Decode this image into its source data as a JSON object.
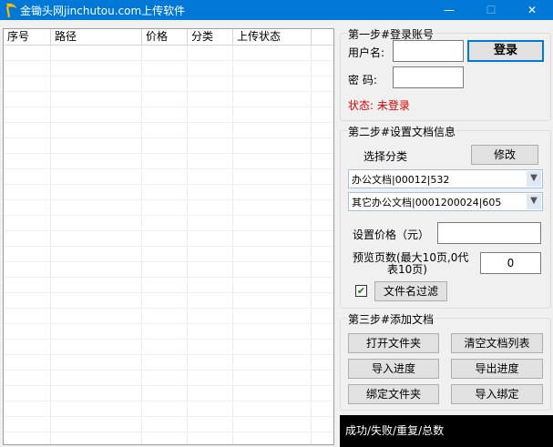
{
  "window": {
    "title": "金锄头网jinchutou.com上传软件",
    "minimize_glyph": "—",
    "maximize_glyph": "☐",
    "close_glyph": "✕",
    "app_icon": "golden-hoe-logo-icon"
  },
  "file_list": {
    "columns": [
      "序号",
      "路径",
      "价格",
      "分类",
      "上传状态"
    ],
    "rows": []
  },
  "step1": {
    "legend": "第一步#登录账号",
    "username_label": "用户名:",
    "username_value": "",
    "password_label": "密   码:",
    "password_value": "",
    "login_button": "登录",
    "status_text": "状态: 未登录",
    "status_color": "#e00000"
  },
  "step2": {
    "legend": "第二步#设置文档信息",
    "choose_category_label": "选择分类",
    "modify_button": "修改",
    "category_primary": "办公文档|00012|532",
    "category_secondary": "其它办公文档|0001200024|605",
    "price_label": "设置价格（元）",
    "price_value": "",
    "preview_pages_label_line1": "预览页数(最大10页,0代",
    "preview_pages_label_line2": "表10页)",
    "preview_pages_value": "0",
    "filename_filter_checked": true,
    "filename_filter_button": "文件名过滤"
  },
  "step3": {
    "legend": "第三步#添加文档",
    "open_folder_button": "打开文件夹",
    "clear_list_button": "清空文档列表",
    "import_progress_button": "导入进度",
    "export_progress_button": "导出进度",
    "bind_folder_button": "绑定文件夹",
    "import_bind_button": "导入绑定"
  },
  "status_bar": {
    "summary_text": "成功/失败/重复/总数"
  },
  "colors": {
    "titlebar": "#0078d7",
    "accent": "#0078d7",
    "status_bar_bg": "#000000"
  }
}
